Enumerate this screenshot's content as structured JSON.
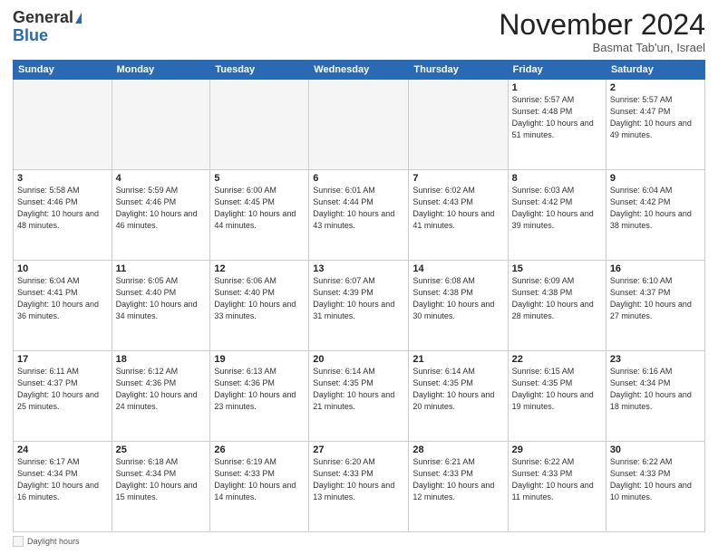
{
  "header": {
    "logo_general": "General",
    "logo_blue": "Blue",
    "month_title": "November 2024",
    "location": "Basmat Tab'un, Israel"
  },
  "days_of_week": [
    "Sunday",
    "Monday",
    "Tuesday",
    "Wednesday",
    "Thursday",
    "Friday",
    "Saturday"
  ],
  "weeks": [
    [
      {
        "day": "",
        "info": ""
      },
      {
        "day": "",
        "info": ""
      },
      {
        "day": "",
        "info": ""
      },
      {
        "day": "",
        "info": ""
      },
      {
        "day": "",
        "info": ""
      },
      {
        "day": "1",
        "info": "Sunrise: 5:57 AM\nSunset: 4:48 PM\nDaylight: 10 hours and 51 minutes."
      },
      {
        "day": "2",
        "info": "Sunrise: 5:57 AM\nSunset: 4:47 PM\nDaylight: 10 hours and 49 minutes."
      }
    ],
    [
      {
        "day": "3",
        "info": "Sunrise: 5:58 AM\nSunset: 4:46 PM\nDaylight: 10 hours and 48 minutes."
      },
      {
        "day": "4",
        "info": "Sunrise: 5:59 AM\nSunset: 4:46 PM\nDaylight: 10 hours and 46 minutes."
      },
      {
        "day": "5",
        "info": "Sunrise: 6:00 AM\nSunset: 4:45 PM\nDaylight: 10 hours and 44 minutes."
      },
      {
        "day": "6",
        "info": "Sunrise: 6:01 AM\nSunset: 4:44 PM\nDaylight: 10 hours and 43 minutes."
      },
      {
        "day": "7",
        "info": "Sunrise: 6:02 AM\nSunset: 4:43 PM\nDaylight: 10 hours and 41 minutes."
      },
      {
        "day": "8",
        "info": "Sunrise: 6:03 AM\nSunset: 4:42 PM\nDaylight: 10 hours and 39 minutes."
      },
      {
        "day": "9",
        "info": "Sunrise: 6:04 AM\nSunset: 4:42 PM\nDaylight: 10 hours and 38 minutes."
      }
    ],
    [
      {
        "day": "10",
        "info": "Sunrise: 6:04 AM\nSunset: 4:41 PM\nDaylight: 10 hours and 36 minutes."
      },
      {
        "day": "11",
        "info": "Sunrise: 6:05 AM\nSunset: 4:40 PM\nDaylight: 10 hours and 34 minutes."
      },
      {
        "day": "12",
        "info": "Sunrise: 6:06 AM\nSunset: 4:40 PM\nDaylight: 10 hours and 33 minutes."
      },
      {
        "day": "13",
        "info": "Sunrise: 6:07 AM\nSunset: 4:39 PM\nDaylight: 10 hours and 31 minutes."
      },
      {
        "day": "14",
        "info": "Sunrise: 6:08 AM\nSunset: 4:38 PM\nDaylight: 10 hours and 30 minutes."
      },
      {
        "day": "15",
        "info": "Sunrise: 6:09 AM\nSunset: 4:38 PM\nDaylight: 10 hours and 28 minutes."
      },
      {
        "day": "16",
        "info": "Sunrise: 6:10 AM\nSunset: 4:37 PM\nDaylight: 10 hours and 27 minutes."
      }
    ],
    [
      {
        "day": "17",
        "info": "Sunrise: 6:11 AM\nSunset: 4:37 PM\nDaylight: 10 hours and 25 minutes."
      },
      {
        "day": "18",
        "info": "Sunrise: 6:12 AM\nSunset: 4:36 PM\nDaylight: 10 hours and 24 minutes."
      },
      {
        "day": "19",
        "info": "Sunrise: 6:13 AM\nSunset: 4:36 PM\nDaylight: 10 hours and 23 minutes."
      },
      {
        "day": "20",
        "info": "Sunrise: 6:14 AM\nSunset: 4:35 PM\nDaylight: 10 hours and 21 minutes."
      },
      {
        "day": "21",
        "info": "Sunrise: 6:14 AM\nSunset: 4:35 PM\nDaylight: 10 hours and 20 minutes."
      },
      {
        "day": "22",
        "info": "Sunrise: 6:15 AM\nSunset: 4:35 PM\nDaylight: 10 hours and 19 minutes."
      },
      {
        "day": "23",
        "info": "Sunrise: 6:16 AM\nSunset: 4:34 PM\nDaylight: 10 hours and 18 minutes."
      }
    ],
    [
      {
        "day": "24",
        "info": "Sunrise: 6:17 AM\nSunset: 4:34 PM\nDaylight: 10 hours and 16 minutes."
      },
      {
        "day": "25",
        "info": "Sunrise: 6:18 AM\nSunset: 4:34 PM\nDaylight: 10 hours and 15 minutes."
      },
      {
        "day": "26",
        "info": "Sunrise: 6:19 AM\nSunset: 4:33 PM\nDaylight: 10 hours and 14 minutes."
      },
      {
        "day": "27",
        "info": "Sunrise: 6:20 AM\nSunset: 4:33 PM\nDaylight: 10 hours and 13 minutes."
      },
      {
        "day": "28",
        "info": "Sunrise: 6:21 AM\nSunset: 4:33 PM\nDaylight: 10 hours and 12 minutes."
      },
      {
        "day": "29",
        "info": "Sunrise: 6:22 AM\nSunset: 4:33 PM\nDaylight: 10 hours and 11 minutes."
      },
      {
        "day": "30",
        "info": "Sunrise: 6:22 AM\nSunset: 4:33 PM\nDaylight: 10 hours and 10 minutes."
      }
    ]
  ],
  "legend": {
    "label": "Daylight hours"
  }
}
